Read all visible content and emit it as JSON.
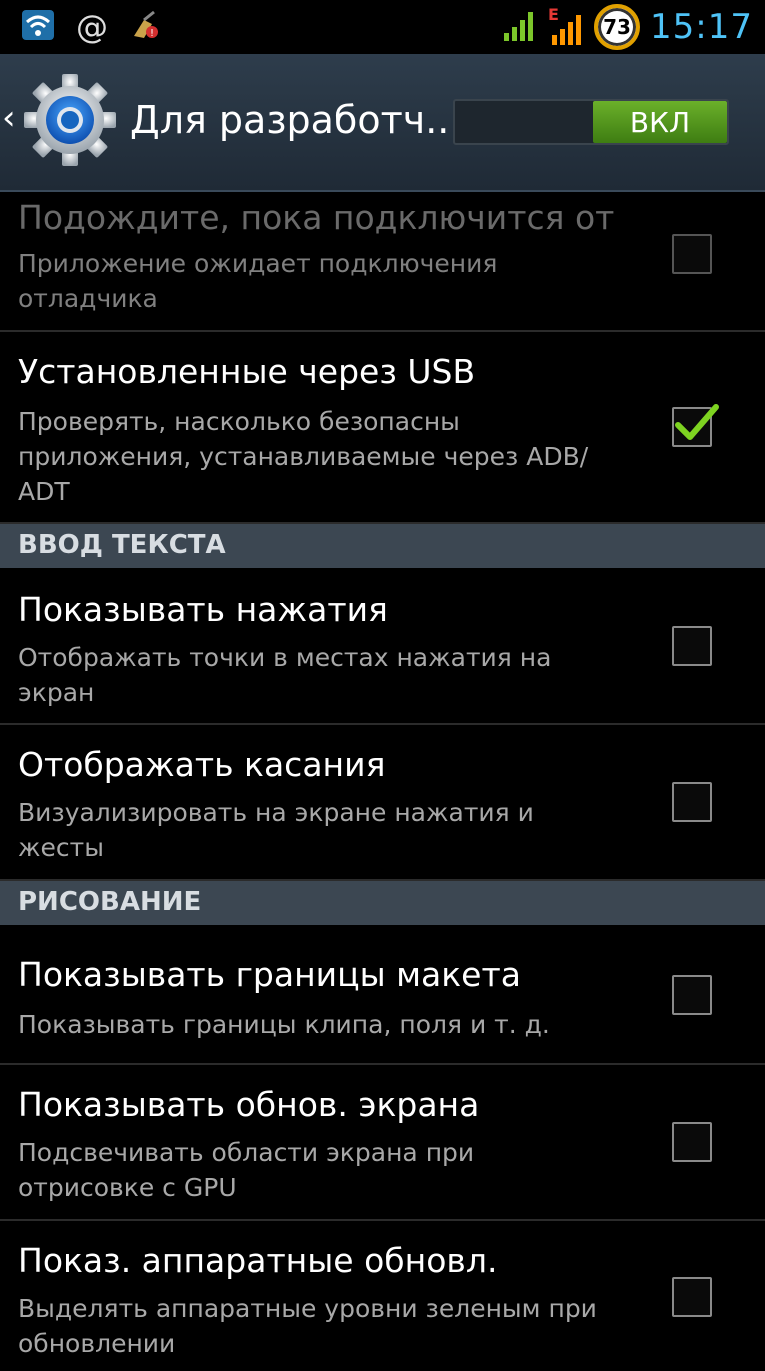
{
  "status_bar": {
    "time": "15:17",
    "battery_level": "73",
    "network_type": "E",
    "icons": [
      "wifi-icon",
      "at-sign-icon",
      "cleaner-icon",
      "signal-icon",
      "signal-roaming-icon",
      "battery-icon"
    ]
  },
  "action_bar": {
    "title": "Для разработч...",
    "switch_label": "ВКЛ",
    "switch_state": "on",
    "icons": [
      "back-chevron-icon",
      "settings-gear-icon"
    ]
  },
  "settings": [
    {
      "type": "item",
      "title": "Подождите, пока подключится от",
      "summary": "Приложение ожидает подключения отладчика",
      "checked": false,
      "disabled": true
    },
    {
      "type": "item",
      "title": "Установленные через USB",
      "summary": "Проверять, насколько безопасны приложения, устанавливаемые через ADB/ ADT",
      "checked": true,
      "disabled": false
    },
    {
      "type": "header",
      "title": "ВВОД ТЕКСТА"
    },
    {
      "type": "item",
      "title": "Показывать нажатия",
      "summary": "Отображать точки в местах нажатия на экран",
      "checked": false,
      "disabled": false
    },
    {
      "type": "item",
      "title": "Отображать касания",
      "summary": "Визуализировать на экране нажатия и жесты",
      "checked": false,
      "disabled": false
    },
    {
      "type": "header",
      "title": "РИСОВАНИЕ"
    },
    {
      "type": "item",
      "title": "Показывать границы макета",
      "summary": "Показывать границы клипа, поля и т. д.",
      "checked": false,
      "disabled": false
    },
    {
      "type": "item",
      "title": "Показывать обнов. экрана",
      "summary": "Подсвечивать области экрана при отрисовке с GPU",
      "checked": false,
      "disabled": false
    },
    {
      "type": "item",
      "title": "Показ. аппаратные обновл.",
      "summary": "Выделять аппаратные уровни зеленым при обновлении",
      "checked": false,
      "disabled": false
    }
  ],
  "colors": {
    "accent_time": "#4fc3f7",
    "switch_on": "#5a9e1e",
    "header_bg": "#3c4752",
    "checkmark": "#7ed321"
  }
}
